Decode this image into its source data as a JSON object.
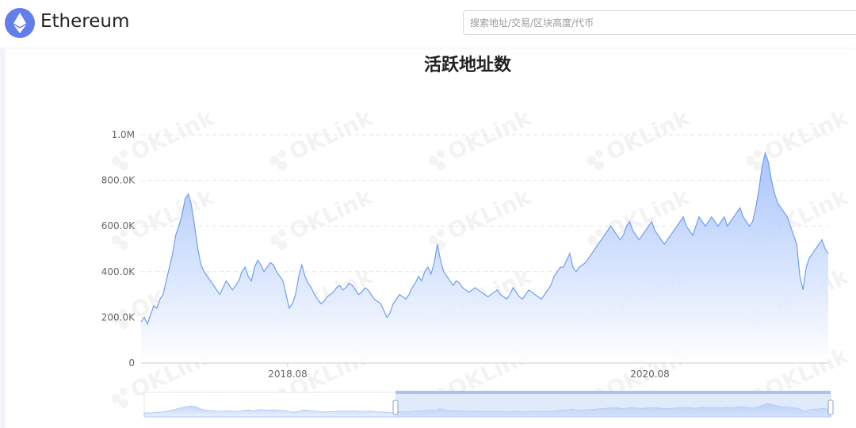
{
  "header": {
    "brand": "Ethereum",
    "logo_icon": "ethereum-icon",
    "search_placeholder": "搜索地址/交易/区块高度/代币",
    "search_value": ""
  },
  "watermark": "OKLink",
  "colors": {
    "line": "#6e9ef5",
    "area_top": "#9fbefb",
    "area_bottom": "#ffffff",
    "grid": "#e6e6e6",
    "brand": "#627eea"
  },
  "chart_data": {
    "type": "area",
    "title": "活跃地址数",
    "xlabel": "",
    "ylabel": "",
    "y_ticks": [
      "0",
      "200.0K",
      "400.0K",
      "600.0K",
      "800.0K",
      "1.0M"
    ],
    "y_tick_values": [
      0,
      200000,
      400000,
      600000,
      800000,
      1000000
    ],
    "ylim": [
      0,
      1000000
    ],
    "x_ticks": [
      "2018.08",
      "2020.08"
    ],
    "xlim": [
      "2017.03",
      "2021.01"
    ],
    "grid": true,
    "grid_style": "dashed",
    "series": [
      {
        "values_date_step": "14 days",
        "x_start": "2017.03",
        "values": [
          180000,
          200000,
          170000,
          210000,
          250000,
          240000,
          280000,
          300000,
          360000,
          420000,
          480000,
          560000,
          600000,
          650000,
          720000,
          740000,
          690000,
          600000,
          500000,
          430000,
          400000,
          380000,
          360000,
          340000,
          320000,
          300000,
          330000,
          360000,
          340000,
          320000,
          340000,
          360000,
          400000,
          420000,
          380000,
          360000,
          420000,
          450000,
          430000,
          400000,
          420000,
          440000,
          430000,
          400000,
          380000,
          360000,
          300000,
          240000,
          260000,
          300000,
          380000,
          430000,
          380000,
          350000,
          330000,
          300000,
          280000,
          260000,
          270000,
          290000,
          300000,
          310000,
          330000,
          340000,
          320000,
          330000,
          350000,
          340000,
          320000,
          300000,
          310000,
          330000,
          320000,
          300000,
          280000,
          270000,
          260000,
          230000,
          200000,
          220000,
          260000,
          280000,
          300000,
          290000,
          280000,
          300000,
          330000,
          350000,
          380000,
          360000,
          400000,
          420000,
          390000,
          440000,
          520000,
          450000,
          400000,
          380000,
          360000,
          340000,
          360000,
          350000,
          330000,
          320000,
          310000,
          320000,
          330000,
          320000,
          310000,
          300000,
          290000,
          300000,
          310000,
          320000,
          300000,
          290000,
          280000,
          300000,
          330000,
          310000,
          290000,
          280000,
          300000,
          320000,
          310000,
          300000,
          290000,
          280000,
          300000,
          320000,
          340000,
          380000,
          400000,
          420000,
          420000,
          450000,
          480000,
          420000,
          400000,
          420000,
          430000,
          440000,
          460000,
          480000,
          500000,
          520000,
          540000,
          560000,
          580000,
          600000,
          580000,
          560000,
          540000,
          560000,
          600000,
          620000,
          580000,
          560000,
          540000,
          560000,
          580000,
          600000,
          620000,
          580000,
          560000,
          540000,
          520000,
          540000,
          560000,
          580000,
          600000,
          620000,
          640000,
          600000,
          580000,
          560000,
          600000,
          640000,
          620000,
          600000,
          620000,
          640000,
          620000,
          600000,
          620000,
          640000,
          600000,
          620000,
          640000,
          660000,
          680000,
          640000,
          620000,
          600000,
          620000,
          680000,
          760000,
          860000,
          920000,
          880000,
          800000,
          740000,
          700000,
          680000,
          660000,
          640000,
          600000,
          560000,
          520000,
          380000,
          320000,
          420000,
          460000,
          480000,
          500000,
          520000,
          540000,
          500000,
          480000
        ]
      }
    ],
    "range_slider": {
      "start": "2018.01",
      "end": "2021.01"
    }
  }
}
